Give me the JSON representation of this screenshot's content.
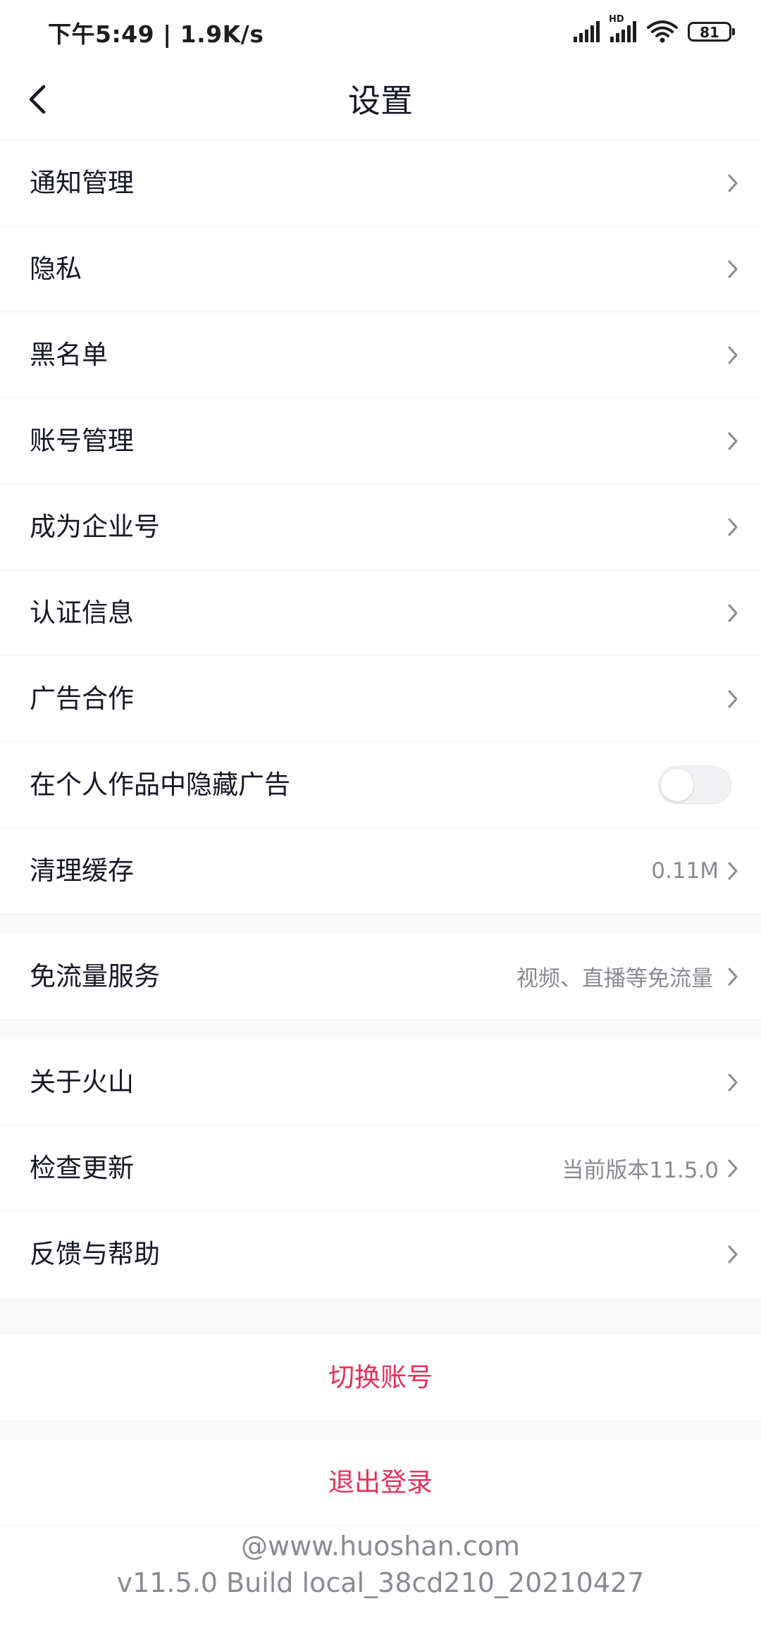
{
  "status_bar": {
    "time": "下午5:49 | 1.9K/s",
    "battery": "81",
    "network_hd": "HD"
  },
  "header": {
    "title": "设置"
  },
  "group1": {
    "items": [
      {
        "label": "通知管理"
      },
      {
        "label": "隐私"
      },
      {
        "label": "黑名单"
      },
      {
        "label": "账号管理"
      },
      {
        "label": "成为企业号"
      },
      {
        "label": "认证信息"
      },
      {
        "label": "广告合作"
      }
    ],
    "hide_ads": {
      "label": "在个人作品中隐藏广告",
      "enabled": false
    },
    "clear_cache": {
      "label": "清理缓存",
      "value": "0.11M"
    }
  },
  "group2": {
    "free_data": {
      "label": "免流量服务",
      "value": "视频、直播等免流量"
    }
  },
  "group3": {
    "about": {
      "label": "关于火山"
    },
    "check_update": {
      "label": "检查更新",
      "value": "当前版本11.5.0"
    },
    "feedback": {
      "label": "反馈与帮助"
    }
  },
  "actions": {
    "switch_account": "切换账号",
    "logout": "退出登录"
  },
  "footer": {
    "site": "@www.huoshan.com",
    "build": "v11.5.0 Build local_38cd210_20210427"
  },
  "colors": {
    "accent": "#e9305a",
    "text_primary": "#161823",
    "text_secondary": "#8a8b91",
    "divider": "#efefef",
    "section_gap": "#f8f8f8"
  },
  "icons": {
    "back": "chevron-left-icon",
    "row_arrow": "chevron-right-icon",
    "signal": "signal-icon",
    "wifi": "wifi-icon",
    "battery": "battery-icon"
  }
}
